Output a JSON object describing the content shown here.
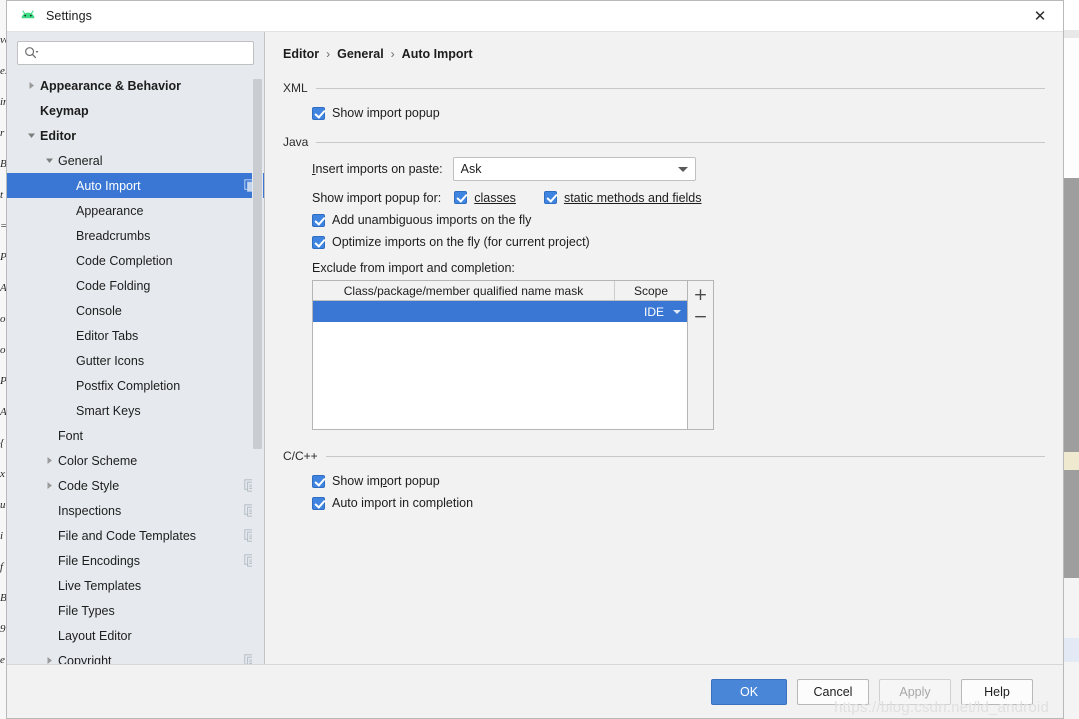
{
  "window": {
    "title": "Settings",
    "logo_icon": "android-studio-logo-icon",
    "close_icon": "close-icon"
  },
  "search": {
    "value": "",
    "placeholder": "",
    "icon": "search-icon"
  },
  "sidebar": {
    "scrollbar": "vertical-scrollbar",
    "items": [
      {
        "label": "Appearance & Behavior",
        "level": 0,
        "bold": true,
        "arrow": "collapsed",
        "sync": false,
        "selected": false
      },
      {
        "label": "Keymap",
        "level": 0,
        "bold": true,
        "arrow": "none",
        "sync": false,
        "selected": false
      },
      {
        "label": "Editor",
        "level": 0,
        "bold": true,
        "arrow": "expanded",
        "sync": false,
        "selected": false
      },
      {
        "label": "General",
        "level": 1,
        "bold": false,
        "arrow": "expanded",
        "sync": false,
        "selected": false
      },
      {
        "label": "Auto Import",
        "level": 2,
        "bold": false,
        "arrow": "none",
        "sync": true,
        "selected": true
      },
      {
        "label": "Appearance",
        "level": 2,
        "bold": false,
        "arrow": "none",
        "sync": false,
        "selected": false
      },
      {
        "label": "Breadcrumbs",
        "level": 2,
        "bold": false,
        "arrow": "none",
        "sync": false,
        "selected": false
      },
      {
        "label": "Code Completion",
        "level": 2,
        "bold": false,
        "arrow": "none",
        "sync": false,
        "selected": false
      },
      {
        "label": "Code Folding",
        "level": 2,
        "bold": false,
        "arrow": "none",
        "sync": false,
        "selected": false
      },
      {
        "label": "Console",
        "level": 2,
        "bold": false,
        "arrow": "none",
        "sync": false,
        "selected": false
      },
      {
        "label": "Editor Tabs",
        "level": 2,
        "bold": false,
        "arrow": "none",
        "sync": false,
        "selected": false
      },
      {
        "label": "Gutter Icons",
        "level": 2,
        "bold": false,
        "arrow": "none",
        "sync": false,
        "selected": false
      },
      {
        "label": "Postfix Completion",
        "level": 2,
        "bold": false,
        "arrow": "none",
        "sync": false,
        "selected": false
      },
      {
        "label": "Smart Keys",
        "level": 2,
        "bold": false,
        "arrow": "none",
        "sync": false,
        "selected": false
      },
      {
        "label": "Font",
        "level": 1,
        "bold": false,
        "arrow": "none",
        "sync": false,
        "selected": false
      },
      {
        "label": "Color Scheme",
        "level": 1,
        "bold": false,
        "arrow": "collapsed",
        "sync": false,
        "selected": false
      },
      {
        "label": "Code Style",
        "level": 1,
        "bold": false,
        "arrow": "collapsed",
        "sync": true,
        "selected": false
      },
      {
        "label": "Inspections",
        "level": 1,
        "bold": false,
        "arrow": "none",
        "sync": true,
        "selected": false
      },
      {
        "label": "File and Code Templates",
        "level": 1,
        "bold": false,
        "arrow": "none",
        "sync": true,
        "selected": false
      },
      {
        "label": "File Encodings",
        "level": 1,
        "bold": false,
        "arrow": "none",
        "sync": true,
        "selected": false
      },
      {
        "label": "Live Templates",
        "level": 1,
        "bold": false,
        "arrow": "none",
        "sync": false,
        "selected": false
      },
      {
        "label": "File Types",
        "level": 1,
        "bold": false,
        "arrow": "none",
        "sync": false,
        "selected": false
      },
      {
        "label": "Layout Editor",
        "level": 1,
        "bold": false,
        "arrow": "none",
        "sync": false,
        "selected": false
      },
      {
        "label": "Copyright",
        "level": 1,
        "bold": false,
        "arrow": "collapsed",
        "sync": true,
        "selected": false
      }
    ]
  },
  "main": {
    "breadcrumb": [
      "Editor",
      "General",
      "Auto Import"
    ],
    "breadcrumb_separator": "›",
    "sections": {
      "xml": {
        "title": "XML",
        "show_import_popup": {
          "label": "Show import popup",
          "checked": true
        }
      },
      "java": {
        "title": "Java",
        "insert_imports_label": "Insert imports on paste:",
        "insert_imports_mnemonic": "I",
        "insert_imports_value": "Ask",
        "show_import_popup_for_label": "Show import popup for:",
        "classes": {
          "label": "classes",
          "mnemonic": "c",
          "checked": true
        },
        "static_methods": {
          "label": "static methods and fields",
          "mnemonic": "s",
          "checked": true
        },
        "add_unambiguous": {
          "label": "Add unambiguous imports on the fly",
          "checked": true
        },
        "optimize_imports": {
          "label": "Optimize imports on the fly (for current project)",
          "checked": true
        },
        "exclude_label": "Exclude from import and completion:",
        "table": {
          "columns": [
            "Class/package/member qualified name mask",
            "Scope"
          ],
          "rows": [
            {
              "mask": "",
              "scope": "IDE",
              "selected": true
            }
          ],
          "add_button": "+",
          "remove_button": "−"
        }
      },
      "cpp": {
        "title": "C/C++",
        "show_import_popup": {
          "label": "Show import popup",
          "mnemonic": "p",
          "checked": true
        },
        "auto_import_completion": {
          "label": "Auto import in completion",
          "checked": true
        }
      }
    }
  },
  "footer": {
    "ok": "OK",
    "cancel": "Cancel",
    "apply": "Apply",
    "help": "Help",
    "apply_disabled": true,
    "watermark": "https://blog.csdn.net/ld_android"
  },
  "colors": {
    "accent": "#3a77d4",
    "primary_button": "#4a86d8",
    "sidebar_bg": "#e6eaee",
    "panel_bg": "#f2f2f2",
    "checkbox": "#3e84e0"
  },
  "background_editor": {
    "left_fragments": [
      "va",
      "e.",
      "in",
      "r",
      "B",
      "t",
      "=",
      "P",
      "A",
      "o",
      "o",
      "P",
      "A",
      "{",
      "x",
      "u",
      "i",
      "f",
      "B",
      "9",
      "e"
    ],
    "right_visible": true
  }
}
